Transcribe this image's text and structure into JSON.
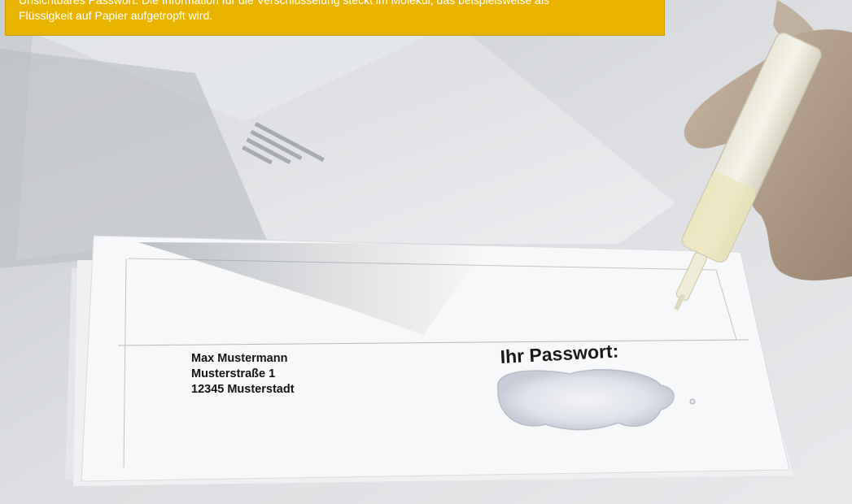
{
  "caption": {
    "line1": "Unsichtbares Passwort: Die Information für die Verschlüsselung steckt im Molekül, das beispielsweise als",
    "line2": "Flüssigkeit auf Papier aufgetropft wird."
  },
  "letter": {
    "recipient_name": "Max Mustermann",
    "recipient_street": "Musterstraße 1",
    "recipient_city": "12345 Musterstadt",
    "password_label": "Ihr Passwort:"
  },
  "colors": {
    "caption_background": "#e8b400",
    "caption_text": "#ffffff"
  }
}
